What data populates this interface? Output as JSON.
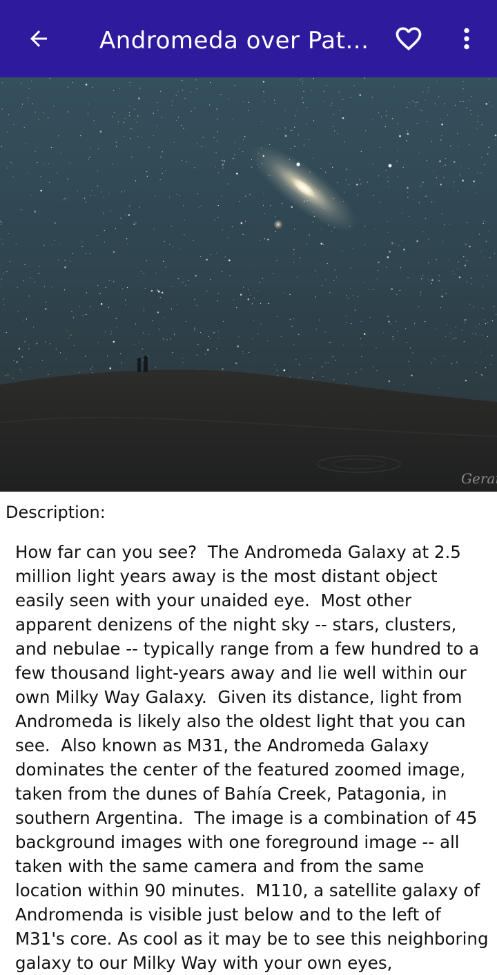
{
  "appbar": {
    "title": "Andromeda over Pat...",
    "back_icon": "arrow-back-icon",
    "favorite_icon": "heart-outline-icon",
    "more_icon": "more-vert-icon",
    "background_color": "#2e1a9c"
  },
  "image": {
    "watermark": "Gerardo"
  },
  "description": {
    "label": "Description:",
    "text": "How far can you see?  The Andromeda Galaxy at 2.5 million light years away is the most distant object easily seen with your unaided eye.  Most other apparent denizens of the night sky -- stars, clusters, and nebulae -- typically range from a few hundred to a few thousand light-years away and lie well within our own Milky Way Galaxy.  Given its distance, light from Andromeda is likely also the oldest light that you can see.  Also known as M31, the Andromeda Galaxy dominates the center of the featured zoomed image, taken from the dunes of Bahía Creek, Patagonia, in southern Argentina.  The image is a combination of 45 background images with one foreground image -- all taken with the same camera and from the same location within 90 minutes.  M110, a satellite galaxy of Andromenda is visible just below and to the left of M31's core. As cool as it may be to see this neighboring galaxy to our Milky Way with your own eyes,"
  }
}
